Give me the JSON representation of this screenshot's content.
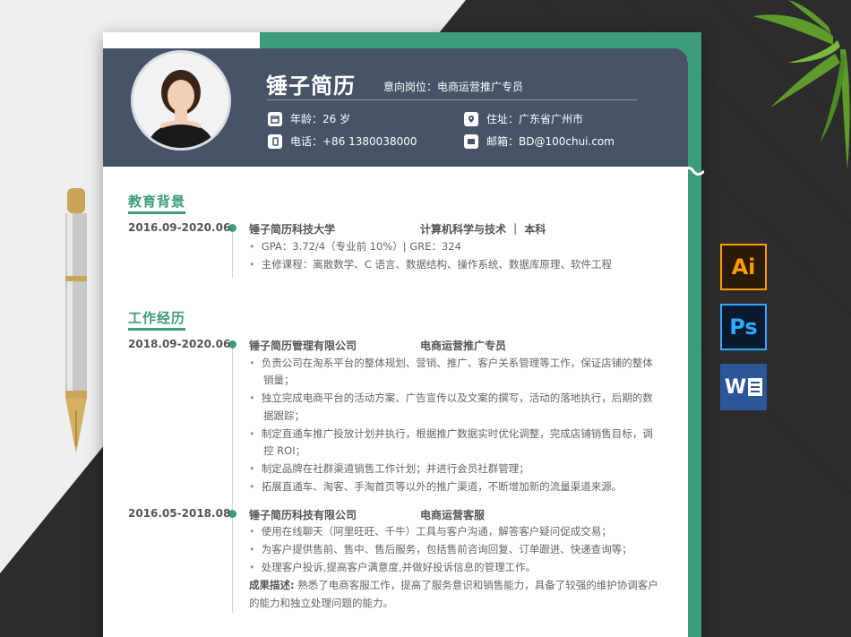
{
  "resume": {
    "name": "锤子简历",
    "intent": "意向岗位：电商运营推广专员",
    "info": {
      "age": "年龄：26 岁",
      "phone": "电话：+86 1380038000",
      "address": "住址：广东省广州市",
      "email": "邮箱：BD@100chui.com"
    }
  },
  "education": {
    "title": "教育背景",
    "date": "2016.09-2020.06",
    "school": "锤子简历科技大学",
    "major": "计算机科学与技术 ｜ 本科",
    "lines": [
      "GPA：3.72/4（专业前 10%）| GRE：324",
      "主修课程：离散数学、C 语言、数据结构、操作系统、数据库原理、软件工程"
    ]
  },
  "work": {
    "title": "工作经历",
    "job1": {
      "date": "2018.09-2020.06",
      "company": "锤子简历管理有限公司",
      "role": "电商运营推广专员",
      "b1a": "负责公司在淘系平台的整体规划、营销、推广、客户关系管理等工作，保证店铺的整体",
      "b1b": "销量；",
      "b2a": "独立完成电商平台的活动方案、广告宣传以及文案的撰写，活动的落地执行，后期的数",
      "b2b": "据跟踪；",
      "b3a": "制定直通车推广投放计划并执行，根据推广数据实时优化调整，完成店铺销售目标，调",
      "b3b": "控 ROI；",
      "b4": "制定品牌在社群渠道销售工作计划；并进行会员社群管理；",
      "b5": "拓展直通车、淘客、手淘首页等以外的推广渠道，不断增加新的流量渠道来源。"
    },
    "job2": {
      "date": "2016.05-2018.08",
      "company": "锤子简历科技有限公司",
      "role": "电商运营客服",
      "b1": "使用在线聊天（阿里旺旺、千牛）工具与客户沟通，解答客户疑问促成交易；",
      "b2": "为客户提供售前、售中、售后服务，包括售前咨询回复、订单跟进、快递查询等；",
      "b3": "处理客户投诉,提高客户满意度,并做好投诉信息的管理工作。",
      "result_label": "成果描述:",
      "result_a": " 熟悉了电商客服工作，提高了服务意识和销售能力，具备了较强的维护协调客户",
      "result_b": "的能力和独立处理问题的能力。"
    }
  },
  "software": {
    "ai": "Ai",
    "ps": "Ps",
    "word": "W"
  },
  "colors": {
    "header": "#475367",
    "accent": "#3c9c7b",
    "dark_bg": "#2b2b2b"
  }
}
